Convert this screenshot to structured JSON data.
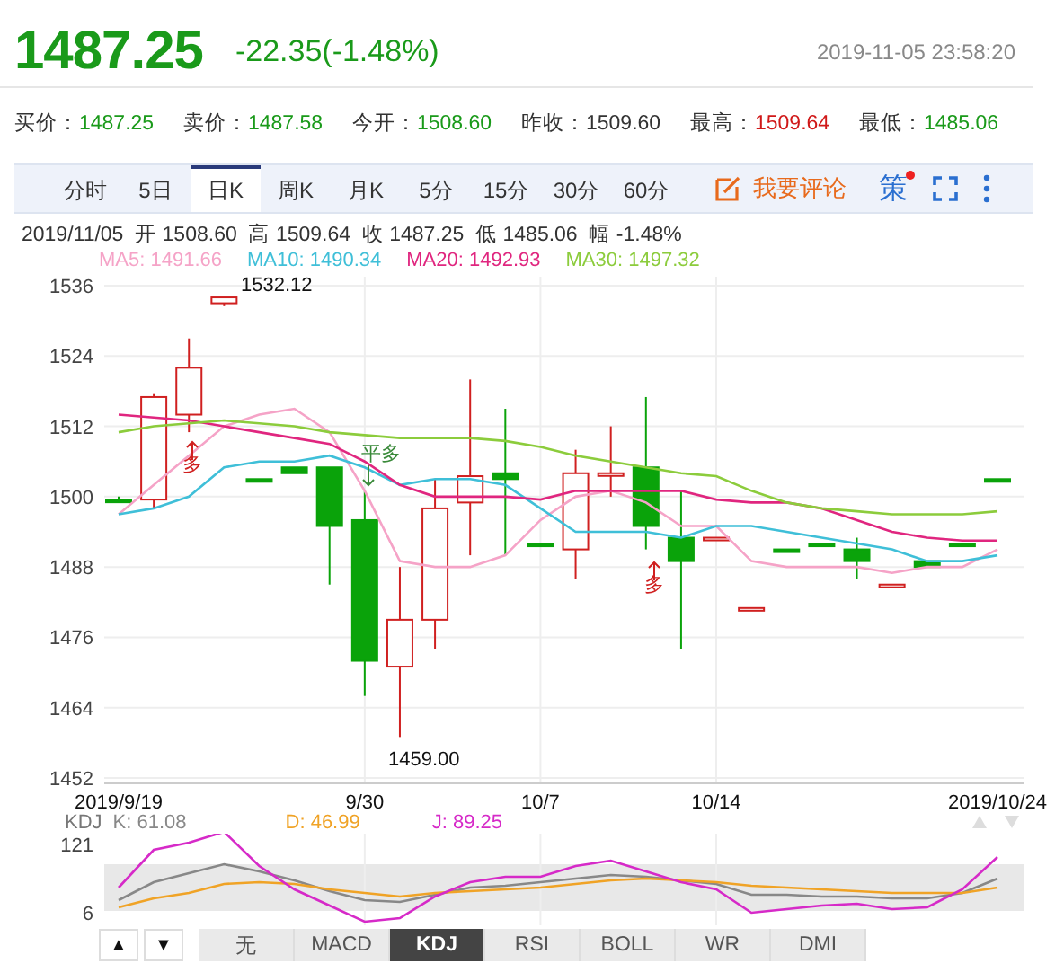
{
  "header": {
    "price": "1487.25",
    "change": "-22.35(-1.48%)",
    "timestamp": "2019-11-05 23:58:20"
  },
  "quotes": [
    {
      "label": "买价：",
      "value": "1487.25",
      "color": "#1a9a1a"
    },
    {
      "label": "卖价：",
      "value": "1487.58",
      "color": "#1a9a1a"
    },
    {
      "label": "今开：",
      "value": "1508.60",
      "color": "#1a9a1a"
    },
    {
      "label": "昨收：",
      "value": "1509.60",
      "color": "#333333"
    },
    {
      "label": "最高：",
      "value": "1509.64",
      "color": "#d01818"
    },
    {
      "label": "最低：",
      "value": "1485.06",
      "color": "#1a9a1a"
    }
  ],
  "period_tabs": [
    {
      "label": "分时",
      "selected": false
    },
    {
      "label": "5日",
      "selected": false
    },
    {
      "label": "日K",
      "selected": true
    },
    {
      "label": "周K",
      "selected": false
    },
    {
      "label": "月K",
      "selected": false
    },
    {
      "label": "5分",
      "selected": false
    },
    {
      "label": "15分",
      "selected": false
    },
    {
      "label": "30分",
      "selected": false
    },
    {
      "label": "60分",
      "selected": false
    }
  ],
  "toolbar": {
    "comment_button": "我要评论",
    "strategy_button": "策",
    "strategy_badge": true
  },
  "day_info": "2019/11/05  开 1508.60  高 1509.64  收 1487.25  低 1485.06  幅 -1.48%",
  "ma_legend": [
    {
      "value": ": 1491.66"
    },
    {
      "value": ": 1490.34"
    },
    {
      "value": ": 1492.93"
    },
    {
      "value": ": 1497.32"
    }
  ],
  "price_chart": {
    "chart_data": {
      "type": "line",
      "categories": [
        "2019/9/19",
        null,
        null,
        null,
        null,
        null,
        null,
        "9/30",
        null,
        null,
        null,
        null,
        "10/7",
        null,
        null,
        null,
        null,
        "10/14",
        null,
        null,
        null,
        null,
        null,
        null,
        null,
        "2019/10/24"
      ],
      "yticks": [
        1536,
        1524,
        1512,
        1500,
        1488,
        1476,
        1464,
        1452
      ],
      "ylim": [
        1452,
        1536
      ],
      "grid": true,
      "series": [
        {
          "name": "MA5",
          "color": "#f5a3c7",
          "values": [
            1497,
            1502,
            1507,
            1512,
            1514,
            1515,
            1511,
            1501,
            1489,
            1488,
            1488,
            1490,
            1496,
            1500,
            1501,
            1499,
            1495,
            1495,
            1489,
            1488,
            1488,
            1488,
            1487,
            1488,
            1488,
            1491
          ]
        },
        {
          "name": "MA10",
          "color": "#3fbfd8",
          "values": [
            1497,
            1498,
            1500,
            1505,
            1506,
            1506,
            1507,
            1505,
            1502,
            1503,
            1503,
            1502,
            1498,
            1494,
            1494,
            1494,
            1493,
            1495,
            1495,
            1494,
            1493,
            1492,
            1491,
            1489,
            1489,
            1490
          ]
        },
        {
          "name": "MA20",
          "color": "#e0267f",
          "values": [
            1514,
            1513.5,
            1513,
            1512,
            1511,
            1510,
            1509,
            1506,
            1502,
            1500,
            1500,
            1500,
            1499.5,
            1501,
            1501,
            1501,
            1501,
            1499.5,
            1499,
            1499,
            1498,
            1496,
            1494,
            1493,
            1492.5,
            1492.5
          ]
        },
        {
          "name": "MA30",
          "color": "#8ccc3c",
          "values": [
            1511,
            1512,
            1512.5,
            1513,
            1512.5,
            1512,
            1511,
            1510.5,
            1510,
            1510,
            1510,
            1509.5,
            1508.5,
            1507,
            1506,
            1505,
            1504,
            1503.5,
            1501,
            1499,
            1498,
            1497.5,
            1497,
            1497,
            1497,
            1497.5
          ]
        }
      ]
    },
    "high_label": "1532.12",
    "low_label": "1459.00",
    "annotations": [
      {
        "text": "多",
        "kind": "buy"
      },
      {
        "text": "平多",
        "kind": "close"
      },
      {
        "text": "多",
        "kind": "buy"
      }
    ]
  },
  "kdj": {
    "name": "KDJ",
    "series": [
      {
        "label": "K: 61.08",
        "color": "#888888"
      },
      {
        "label": "D: 46.99",
        "color": "#f0a326"
      },
      {
        "label": "J: 89.25",
        "color": "#d62ac8"
      }
    ],
    "yticks": [
      "121",
      "6"
    ]
  },
  "indicator_tabs": [
    {
      "label": "无",
      "selected": false
    },
    {
      "label": "MACD",
      "selected": false
    },
    {
      "label": "KDJ",
      "selected": true
    },
    {
      "label": "RSI",
      "selected": false
    },
    {
      "label": "BOLL",
      "selected": false
    },
    {
      "label": "WR",
      "selected": false
    },
    {
      "label": "DMI",
      "selected": false
    }
  ],
  "arrow_buttons": [
    "▲",
    "▼"
  ]
}
